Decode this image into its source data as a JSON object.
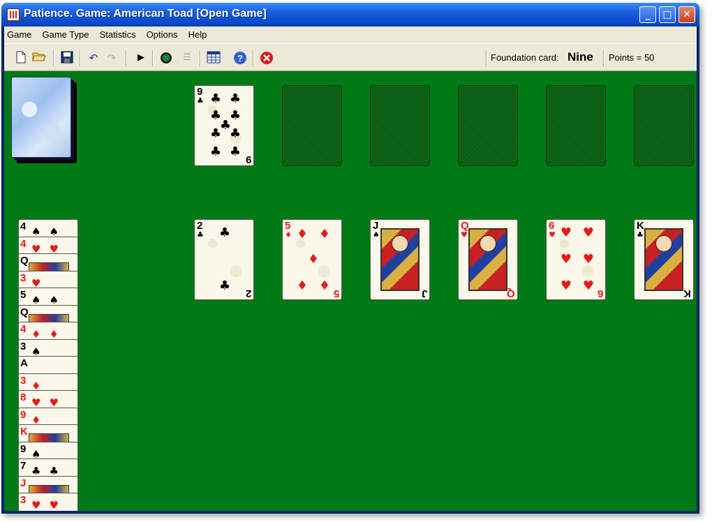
{
  "window": {
    "title": "Patience. Game: American Toad  [Open Game]"
  },
  "menu": [
    "Game",
    "Game Type",
    "Statistics",
    "Options",
    "Help"
  ],
  "toolbar": {
    "foundation_label": "Foundation card:",
    "foundation_value": "Nine",
    "points": "Points = 50"
  },
  "foundation_cards": [
    {
      "rank": "9",
      "suit": "♣",
      "color": "black"
    }
  ],
  "tableau": [
    {
      "rank": "2",
      "suit": "♣",
      "color": "black"
    },
    {
      "rank": "5",
      "suit": "♦",
      "color": "red"
    },
    {
      "rank": "J",
      "suit": "♠",
      "color": "black"
    },
    {
      "rank": "Q",
      "suit": "♥",
      "color": "red"
    },
    {
      "rank": "6",
      "suit": "♥",
      "color": "red"
    },
    {
      "rank": "K",
      "suit": "♣",
      "color": "black"
    }
  ],
  "reserve": [
    {
      "rank": "4",
      "suit": "♠",
      "color": "black"
    },
    {
      "rank": "4",
      "suit": "♥",
      "color": "red"
    },
    {
      "rank": "Q",
      "suit": "♠",
      "color": "black"
    },
    {
      "rank": "3",
      "suit": "♥",
      "color": "red"
    },
    {
      "rank": "5",
      "suit": "♠",
      "color": "black"
    },
    {
      "rank": "Q",
      "suit": "♣",
      "color": "black"
    },
    {
      "rank": "4",
      "suit": "♦",
      "color": "red"
    },
    {
      "rank": "3",
      "suit": "♠",
      "color": "black"
    },
    {
      "rank": "A",
      "suit": "",
      "color": "black"
    },
    {
      "rank": "3",
      "suit": "♦",
      "color": "red"
    },
    {
      "rank": "8",
      "suit": "♥",
      "color": "red"
    },
    {
      "rank": "9",
      "suit": "♦",
      "color": "red"
    },
    {
      "rank": "K",
      "suit": "♥",
      "color": "red"
    },
    {
      "rank": "9",
      "suit": "♠",
      "color": "black"
    },
    {
      "rank": "7",
      "suit": "♣",
      "color": "black"
    },
    {
      "rank": "J",
      "suit": "♦",
      "color": "red"
    },
    {
      "rank": "3",
      "suit": "♥",
      "color": "red"
    }
  ],
  "colors": {
    "felt": "#007a14",
    "red_suit": "#e41b1b",
    "titlebar": "#1d62e0"
  }
}
